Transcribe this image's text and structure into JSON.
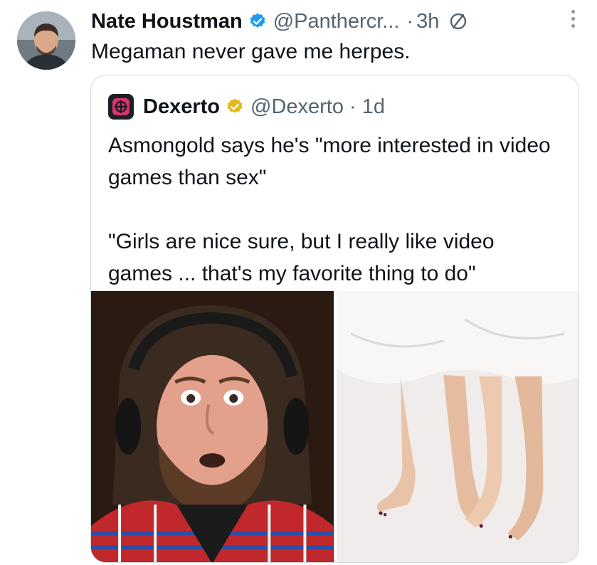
{
  "tweet": {
    "author_name": "Nate Houstman",
    "handle": "@Panthercr...",
    "dot": "·",
    "time": "3h",
    "text": "Megaman never gave me herpes."
  },
  "quoted": {
    "author_name": "Dexerto",
    "handle": "@Dexerto · 1d",
    "paragraphs": [
      "Asmongold says he's \"more interested in video games than sex\"",
      "\"Girls are nice sure, but I really like video games ... that's my favorite thing to do\""
    ]
  },
  "colors": {
    "verified_blue": "#1d9bf0",
    "verified_gold": "#e2b719",
    "muted_text": "#536471"
  },
  "icons": {
    "verified": "verified-badge-icon",
    "ban": "no-reply-icon",
    "more": "more-options-icon"
  }
}
